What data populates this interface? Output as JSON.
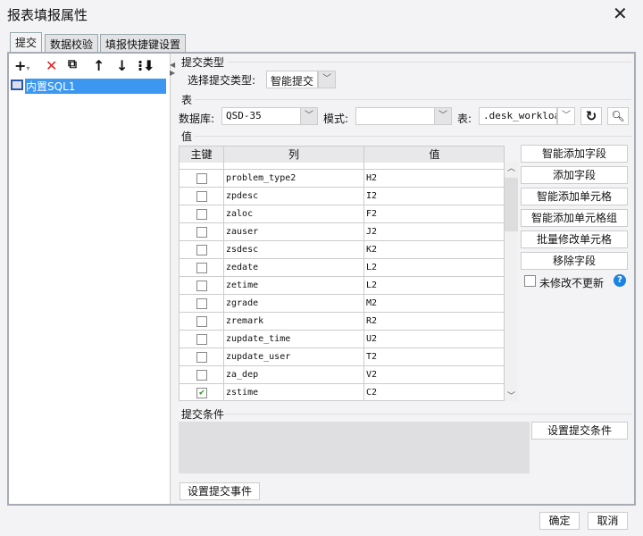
{
  "window": {
    "title": "报表填报属性",
    "close_icon": "close-icon"
  },
  "tabs": [
    {
      "label": "提交",
      "active": true
    },
    {
      "label": "数据校验"
    },
    {
      "label": "填报快捷键设置"
    }
  ],
  "tree": {
    "item": "内置SQL1"
  },
  "submit_type": {
    "group": "提交类型",
    "label": "选择提交类型:",
    "value": "智能提交"
  },
  "table_section": {
    "group": "表",
    "db_label": "数据库:",
    "db_value": "QSD-35",
    "schema_label": "模式:",
    "schema_value": "",
    "table_label": "表:",
    "table_value": ".desk_workload"
  },
  "values": {
    "group": "值",
    "headers": [
      "主键",
      "列",
      "值"
    ],
    "rows": [
      {
        "key": false,
        "col": "problem_type2",
        "val": "H2"
      },
      {
        "key": false,
        "col": "zpdesc",
        "val": "I2"
      },
      {
        "key": false,
        "col": "zaloc",
        "val": "F2"
      },
      {
        "key": false,
        "col": "zauser",
        "val": "J2"
      },
      {
        "key": false,
        "col": "zsdesc",
        "val": "K2"
      },
      {
        "key": false,
        "col": "zedate",
        "val": "L2"
      },
      {
        "key": false,
        "col": "zetime",
        "val": "L2"
      },
      {
        "key": false,
        "col": "zgrade",
        "val": "M2"
      },
      {
        "key": false,
        "col": "zremark",
        "val": "R2"
      },
      {
        "key": false,
        "col": "zupdate_time",
        "val": "U2"
      },
      {
        "key": false,
        "col": "zupdate_user",
        "val": "T2"
      },
      {
        "key": false,
        "col": "za_dep",
        "val": "V2"
      },
      {
        "key": true,
        "col": "zstime",
        "val": "C2"
      }
    ]
  },
  "side_buttons": [
    "智能添加字段",
    "添加字段",
    "智能添加单元格",
    "智能添加单元格组",
    "批量修改单元格",
    "移除字段"
  ],
  "no_update": {
    "label": "未修改不更新",
    "checked": false
  },
  "condition": {
    "group": "提交条件",
    "button": "设置提交条件"
  },
  "event_button": "设置提交事件",
  "footer": {
    "ok": "确定",
    "cancel": "取消"
  }
}
